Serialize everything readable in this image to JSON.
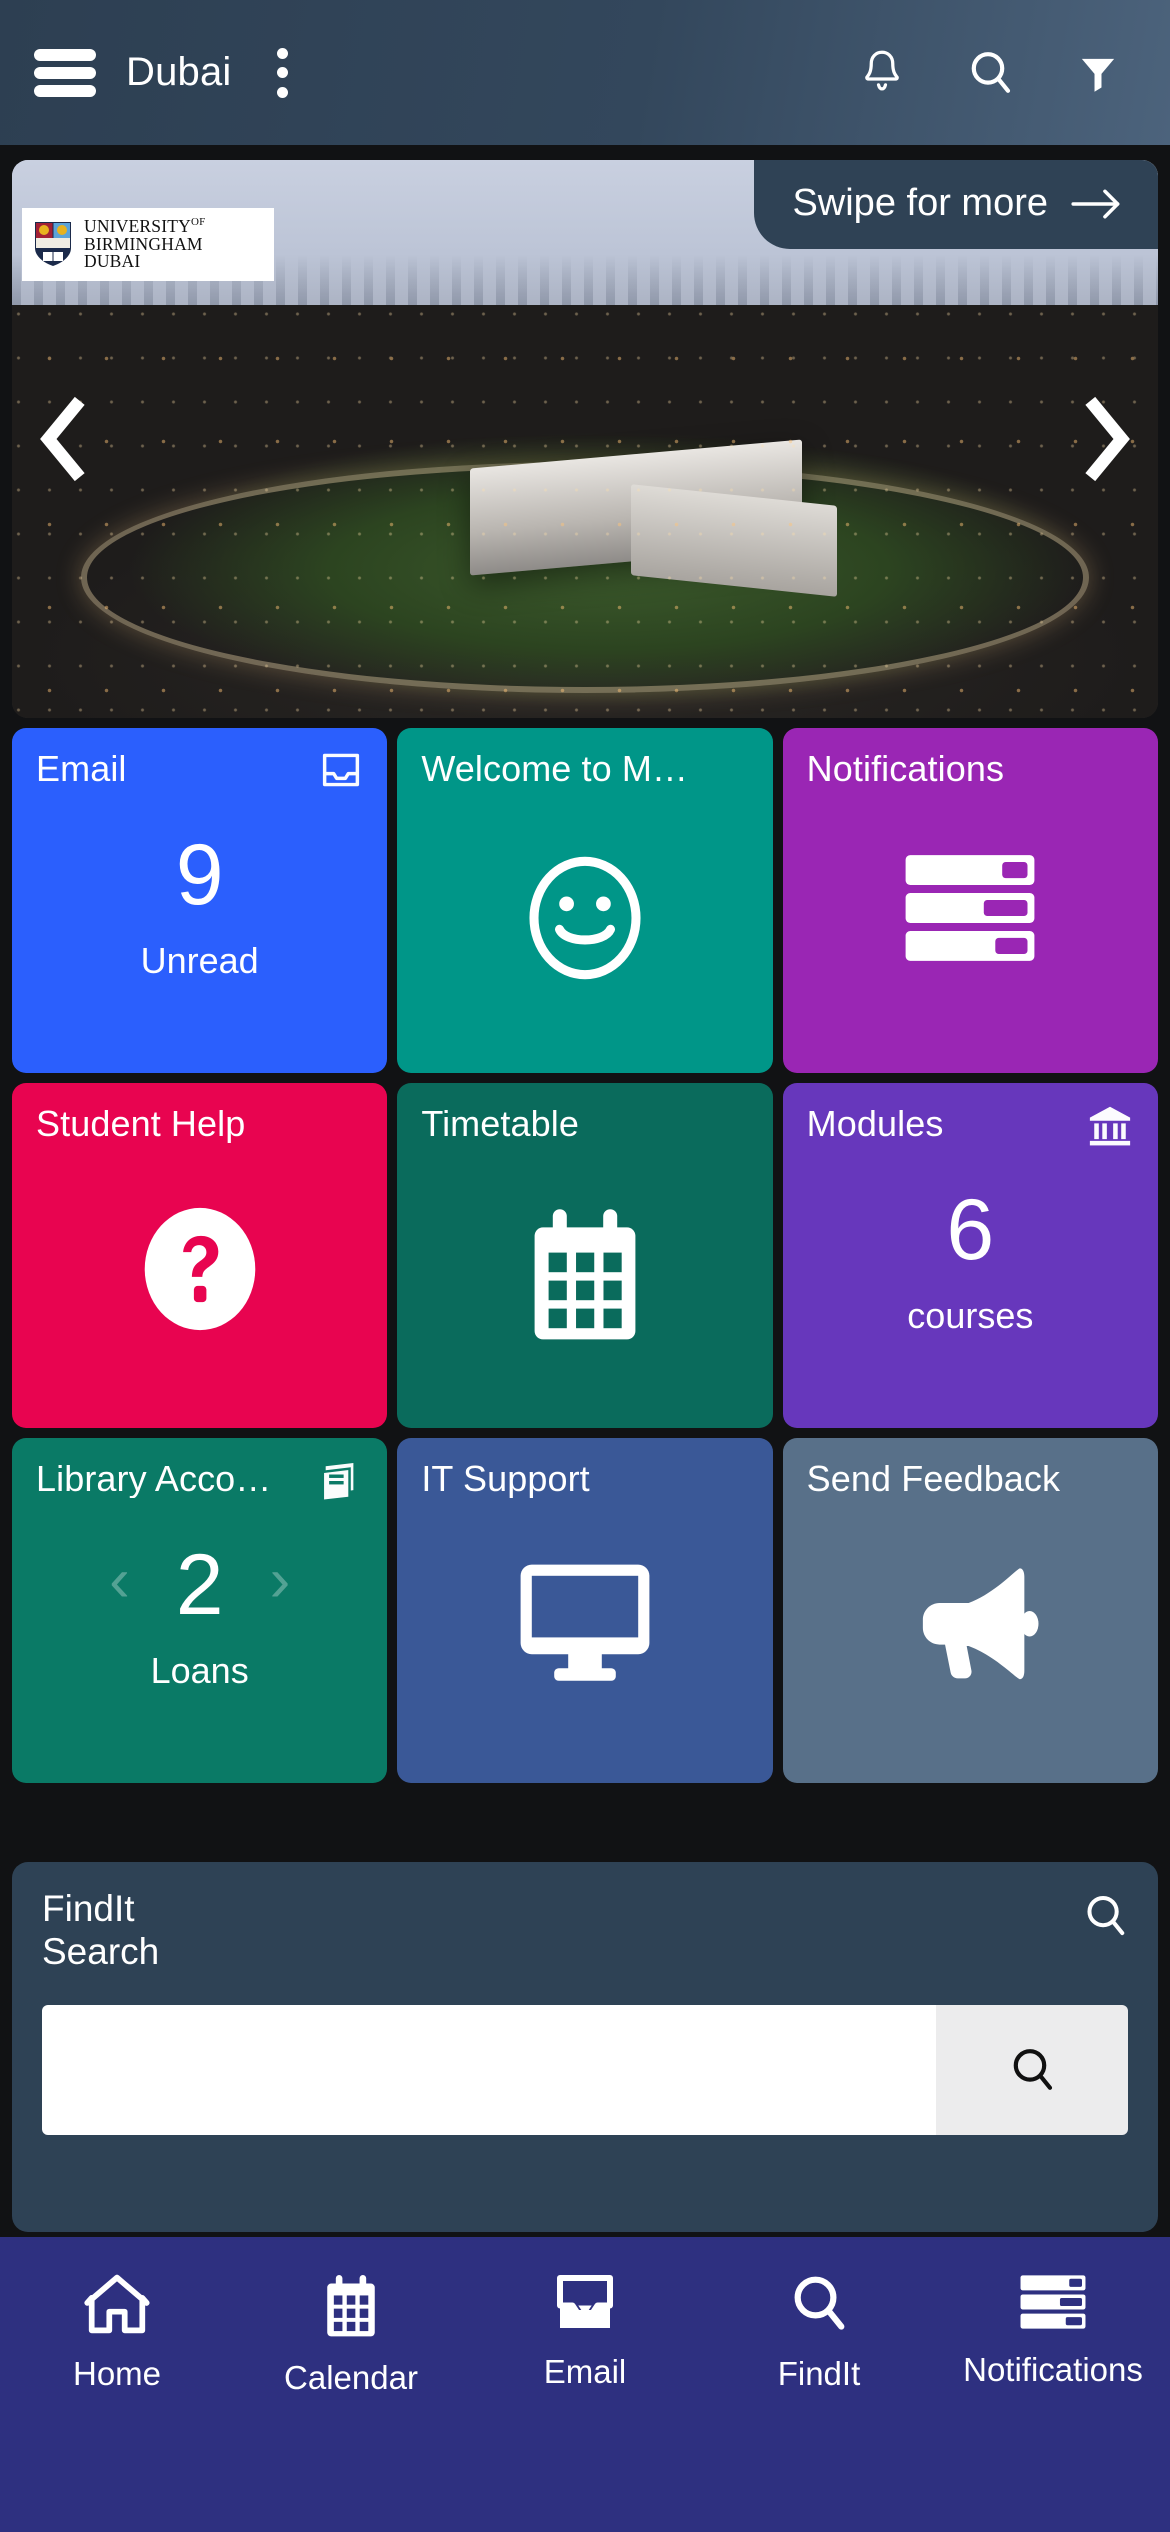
{
  "header": {
    "title": "Dubai",
    "menu_icon": "hamburger-menu-icon",
    "overflow_icon": "kebab-menu-icon",
    "icons": [
      "notifications-bell-icon",
      "search-icon",
      "filter-icon"
    ],
    "background_color": "#33475c"
  },
  "hero": {
    "swipe_label": "Swipe for more",
    "swipe_arrow": "→",
    "prev_arrow": "‹",
    "next_arrow": "›",
    "logo": {
      "line1": "UNIVERSITY",
      "line1_sup": "OF",
      "line2": "BIRMINGHAM",
      "line3": "DUBAI"
    }
  },
  "tiles": [
    {
      "title": "Email",
      "icon": "inbox-icon",
      "value": "9",
      "sub": "Unread",
      "color": "#2b5ffd",
      "name": "email"
    },
    {
      "title": "Welcome to M…",
      "icon": "",
      "value": "",
      "sub": "",
      "color": "#009688",
      "name": "welcome",
      "center_icon": "smiley-face-icon"
    },
    {
      "title": "Notifications",
      "icon": "",
      "value": "",
      "sub": "",
      "color": "#9a26b4",
      "name": "notifications",
      "center_icon": "notifications-list-icon"
    },
    {
      "title": "Student Help",
      "icon": "",
      "value": "",
      "sub": "",
      "color": "#e80450",
      "name": "student-help",
      "center_icon": "question-mark-icon"
    },
    {
      "title": "Timetable",
      "icon": "",
      "value": "",
      "sub": "",
      "color": "#0a6b5c",
      "name": "timetable",
      "center_icon": "calendar-icon"
    },
    {
      "title": "Modules",
      "icon": "bank-icon",
      "value": "6",
      "sub": "courses",
      "color": "#6737bc",
      "name": "modules"
    },
    {
      "title": "Library Acco…",
      "icon": "book-icon",
      "value": "2",
      "sub": "Loans",
      "color": "#0a7a66",
      "name": "library-account",
      "prev": "‹",
      "next": "›"
    },
    {
      "title": "IT Support",
      "icon": "",
      "value": "",
      "sub": "",
      "color": "#3a5897",
      "name": "it-support",
      "center_icon": "monitor-icon"
    },
    {
      "title": "Send Feedback",
      "icon": "",
      "value": "",
      "sub": "",
      "color": "#587089",
      "name": "send-feedback",
      "center_icon": "megaphone-icon"
    }
  ],
  "findit": {
    "title_line1": "FindIt",
    "title_line2": "Search",
    "input_value": "",
    "input_placeholder": "",
    "header_icon": "search-icon",
    "button_icon": "search-icon",
    "panel_color": "#2e4255"
  },
  "bottom_nav": {
    "background_color": "#2e3080",
    "items": [
      {
        "label": "Home",
        "icon": "home-icon"
      },
      {
        "label": "Calendar",
        "icon": "calendar-icon"
      },
      {
        "label": "Email",
        "icon": "inbox-icon"
      },
      {
        "label": "FindIt",
        "icon": "search-icon"
      },
      {
        "label": "Notifications",
        "icon": "notifications-list-icon"
      }
    ]
  }
}
